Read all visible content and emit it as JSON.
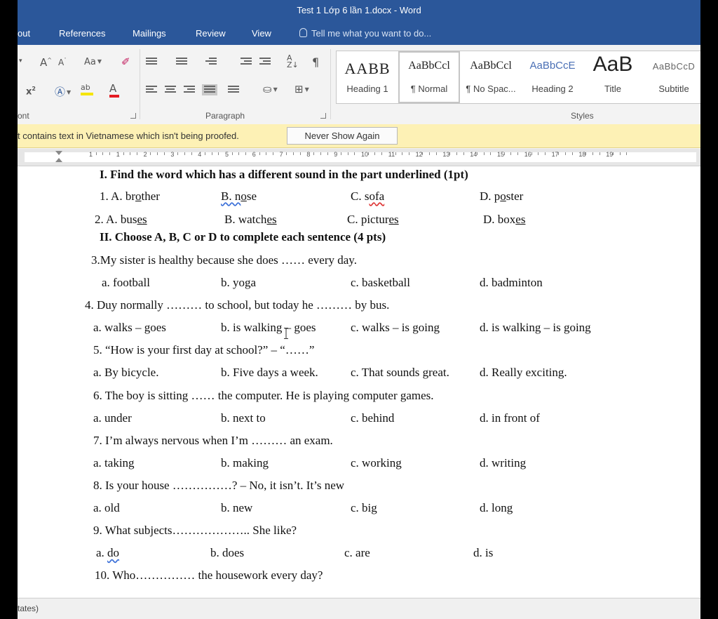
{
  "window": {
    "title": "Test 1  Lớp 6 lần 1.docx - Word"
  },
  "tabs": {
    "items": [
      "out",
      "References",
      "Mailings",
      "Review",
      "View"
    ],
    "tell_me": "Tell me what you want to do..."
  },
  "ribbon": {
    "font_group_label": "ont",
    "paragraph_group_label": "Paragraph",
    "styles_group_label": "Styles",
    "change_case": "Aa",
    "styles": [
      {
        "sample": "AABB",
        "name": "Heading 1"
      },
      {
        "sample": "AaBbCcl",
        "name": "¶ Normal"
      },
      {
        "sample": "AaBbCcl",
        "name": "¶ No Spac..."
      },
      {
        "sample": "AaBbCcE",
        "name": "Heading 2"
      },
      {
        "sample": "AaB",
        "name": "Title"
      },
      {
        "sample": "AaBbCcD",
        "name": "Subtitle"
      }
    ]
  },
  "message_bar": {
    "text": "t contains text in Vietnamese which isn't being proofed.",
    "button": "Never Show Again"
  },
  "ruler": {
    "numbers": [
      "1",
      "1",
      "2",
      "3",
      "4",
      "5",
      "6",
      "7",
      "8",
      "9",
      "10",
      "11",
      "12",
      "13",
      "14",
      "15",
      "16",
      "17",
      "18",
      "19"
    ]
  },
  "document": {
    "h1": "I. Find the word which has a different sound in the part underlined (1pt)",
    "q1": {
      "num": "1. A. br",
      "a_u": "o",
      "a_rest": "ther",
      "b_pre": "B. n",
      "b_u": "o",
      "b_rest": "se",
      "c_pre": "C. s",
      "c_u": "o",
      "c_rest": "fa",
      "d_pre": "D. p",
      "d_u": "o",
      "d_rest": "ster"
    },
    "q2": {
      "num": "2. A. bus",
      "a_u": "es",
      "b_pre": "B. watch",
      "b_u": "es",
      "c_pre": "C. pictur",
      "c_u": "es",
      "d_pre": "D. box",
      "d_u": "es"
    },
    "h2": "II. Choose A, B, C or D to complete each sentence (4 pts)",
    "questions": [
      {
        "text": "3.My sister is healthy because she does …… every day.",
        "a": "a. football",
        "b": "b. yoga",
        "c": "c. basketball",
        "d": "d. badminton"
      },
      {
        "text": "4. Duy normally ……… to school, but today he ……… by bus.",
        "a": "a. walks – goes",
        "b": "b. is walking – goes",
        "c": "c. walks – is going",
        "d": "d. is walking – is going"
      },
      {
        "text": "5. “How is your first day at school?” – “……”",
        "a": "a. By bicycle.",
        "b": "b. Five days a week.",
        "c": "c. That sounds great.",
        "d": "d. Really exciting."
      },
      {
        "text": "6. The boy is sitting …… the computer. He is playing computer games.",
        "a": "a. under",
        "b": "b. next to",
        "c": "c. behind",
        "d": "d. in front of"
      },
      {
        "text": "7. I’m always nervous when I’m ……… an exam.",
        "a": "a. taking",
        "b": "b. making",
        "c": "c. working",
        "d": "d. writing"
      },
      {
        "text": "8. Is your house ……………? – No, it isn’t. It’s new",
        "a": "a. old",
        "b": "b. new",
        "c": "c. big",
        "d": "d. long"
      },
      {
        "text": "9. What subjects……………….. She like?",
        "a": "a. do",
        "b": "b. does",
        "c": "c. are",
        "d": "d. is"
      },
      {
        "text": "10. Who…………… the housework every day?",
        "a": "",
        "b": "",
        "c": "",
        "d": ""
      }
    ]
  },
  "status_bar": {
    "text": "tates)"
  }
}
